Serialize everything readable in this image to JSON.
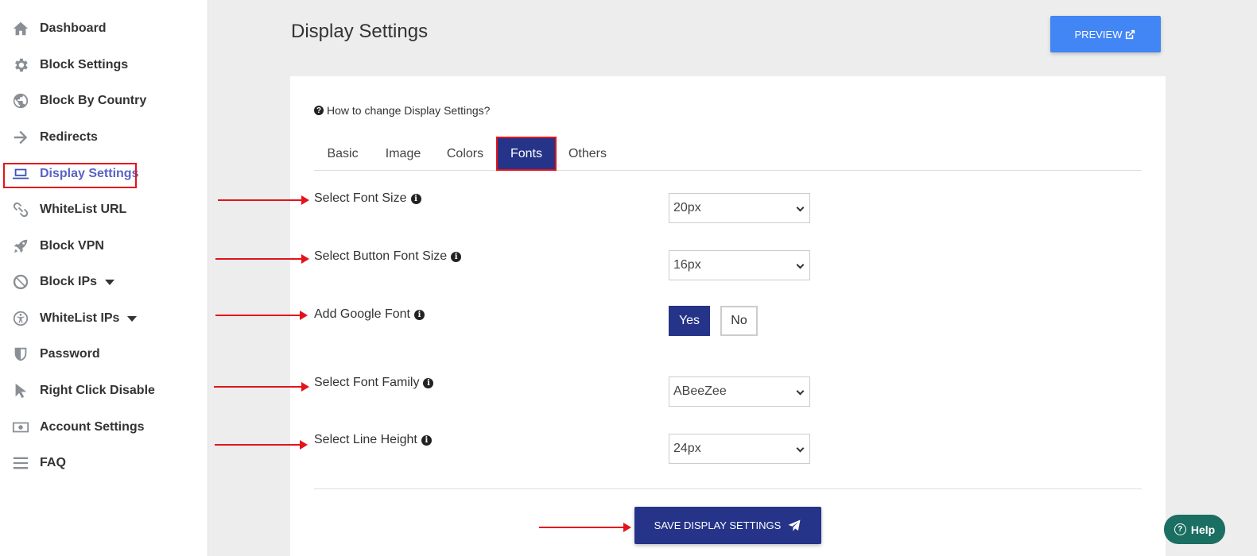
{
  "sidebar": {
    "items": [
      {
        "label": "Dashboard",
        "icon": "home-icon"
      },
      {
        "label": "Block Settings",
        "icon": "gear-icon"
      },
      {
        "label": "Block By Country",
        "icon": "globe-icon"
      },
      {
        "label": "Redirects",
        "icon": "arrow-right-icon"
      },
      {
        "label": "Display Settings",
        "icon": "laptop-icon",
        "active": true
      },
      {
        "label": "WhiteList URL",
        "icon": "link-icon"
      },
      {
        "label": "Block VPN",
        "icon": "rocket-icon"
      },
      {
        "label": "Block IPs",
        "icon": "ban-icon",
        "has_dropdown": true
      },
      {
        "label": "WhiteList IPs",
        "icon": "accessibility-icon",
        "has_dropdown": true
      },
      {
        "label": "Password",
        "icon": "shield-icon"
      },
      {
        "label": "Right Click Disable",
        "icon": "cursor-icon"
      },
      {
        "label": "Account Settings",
        "icon": "money-icon"
      },
      {
        "label": "FAQ",
        "icon": "bars-icon"
      }
    ]
  },
  "header": {
    "title": "Display Settings",
    "preview_label": "PREVIEW"
  },
  "help_link": "How to change Display Settings?",
  "tabs": [
    {
      "label": "Basic"
    },
    {
      "label": "Image"
    },
    {
      "label": "Colors"
    },
    {
      "label": "Fonts",
      "active": true
    },
    {
      "label": "Others"
    }
  ],
  "fields": {
    "font_size": {
      "label": "Select Font Size",
      "value": "20px"
    },
    "button_font_size": {
      "label": "Select Button Font Size",
      "value": "16px"
    },
    "google_font": {
      "label": "Add Google Font",
      "yes_label": "Yes",
      "no_label": "No",
      "selected": "Yes"
    },
    "font_family": {
      "label": "Select Font Family",
      "value": "ABeeZee"
    },
    "line_height": {
      "label": "Select Line Height",
      "value": "24px"
    }
  },
  "save_label": "SAVE DISPLAY SETTINGS",
  "help_widget_label": "Help",
  "colors": {
    "primary": "#253488",
    "preview": "#4285f4",
    "annotation_red": "#e4131b",
    "help_widget": "#1b6e62"
  }
}
